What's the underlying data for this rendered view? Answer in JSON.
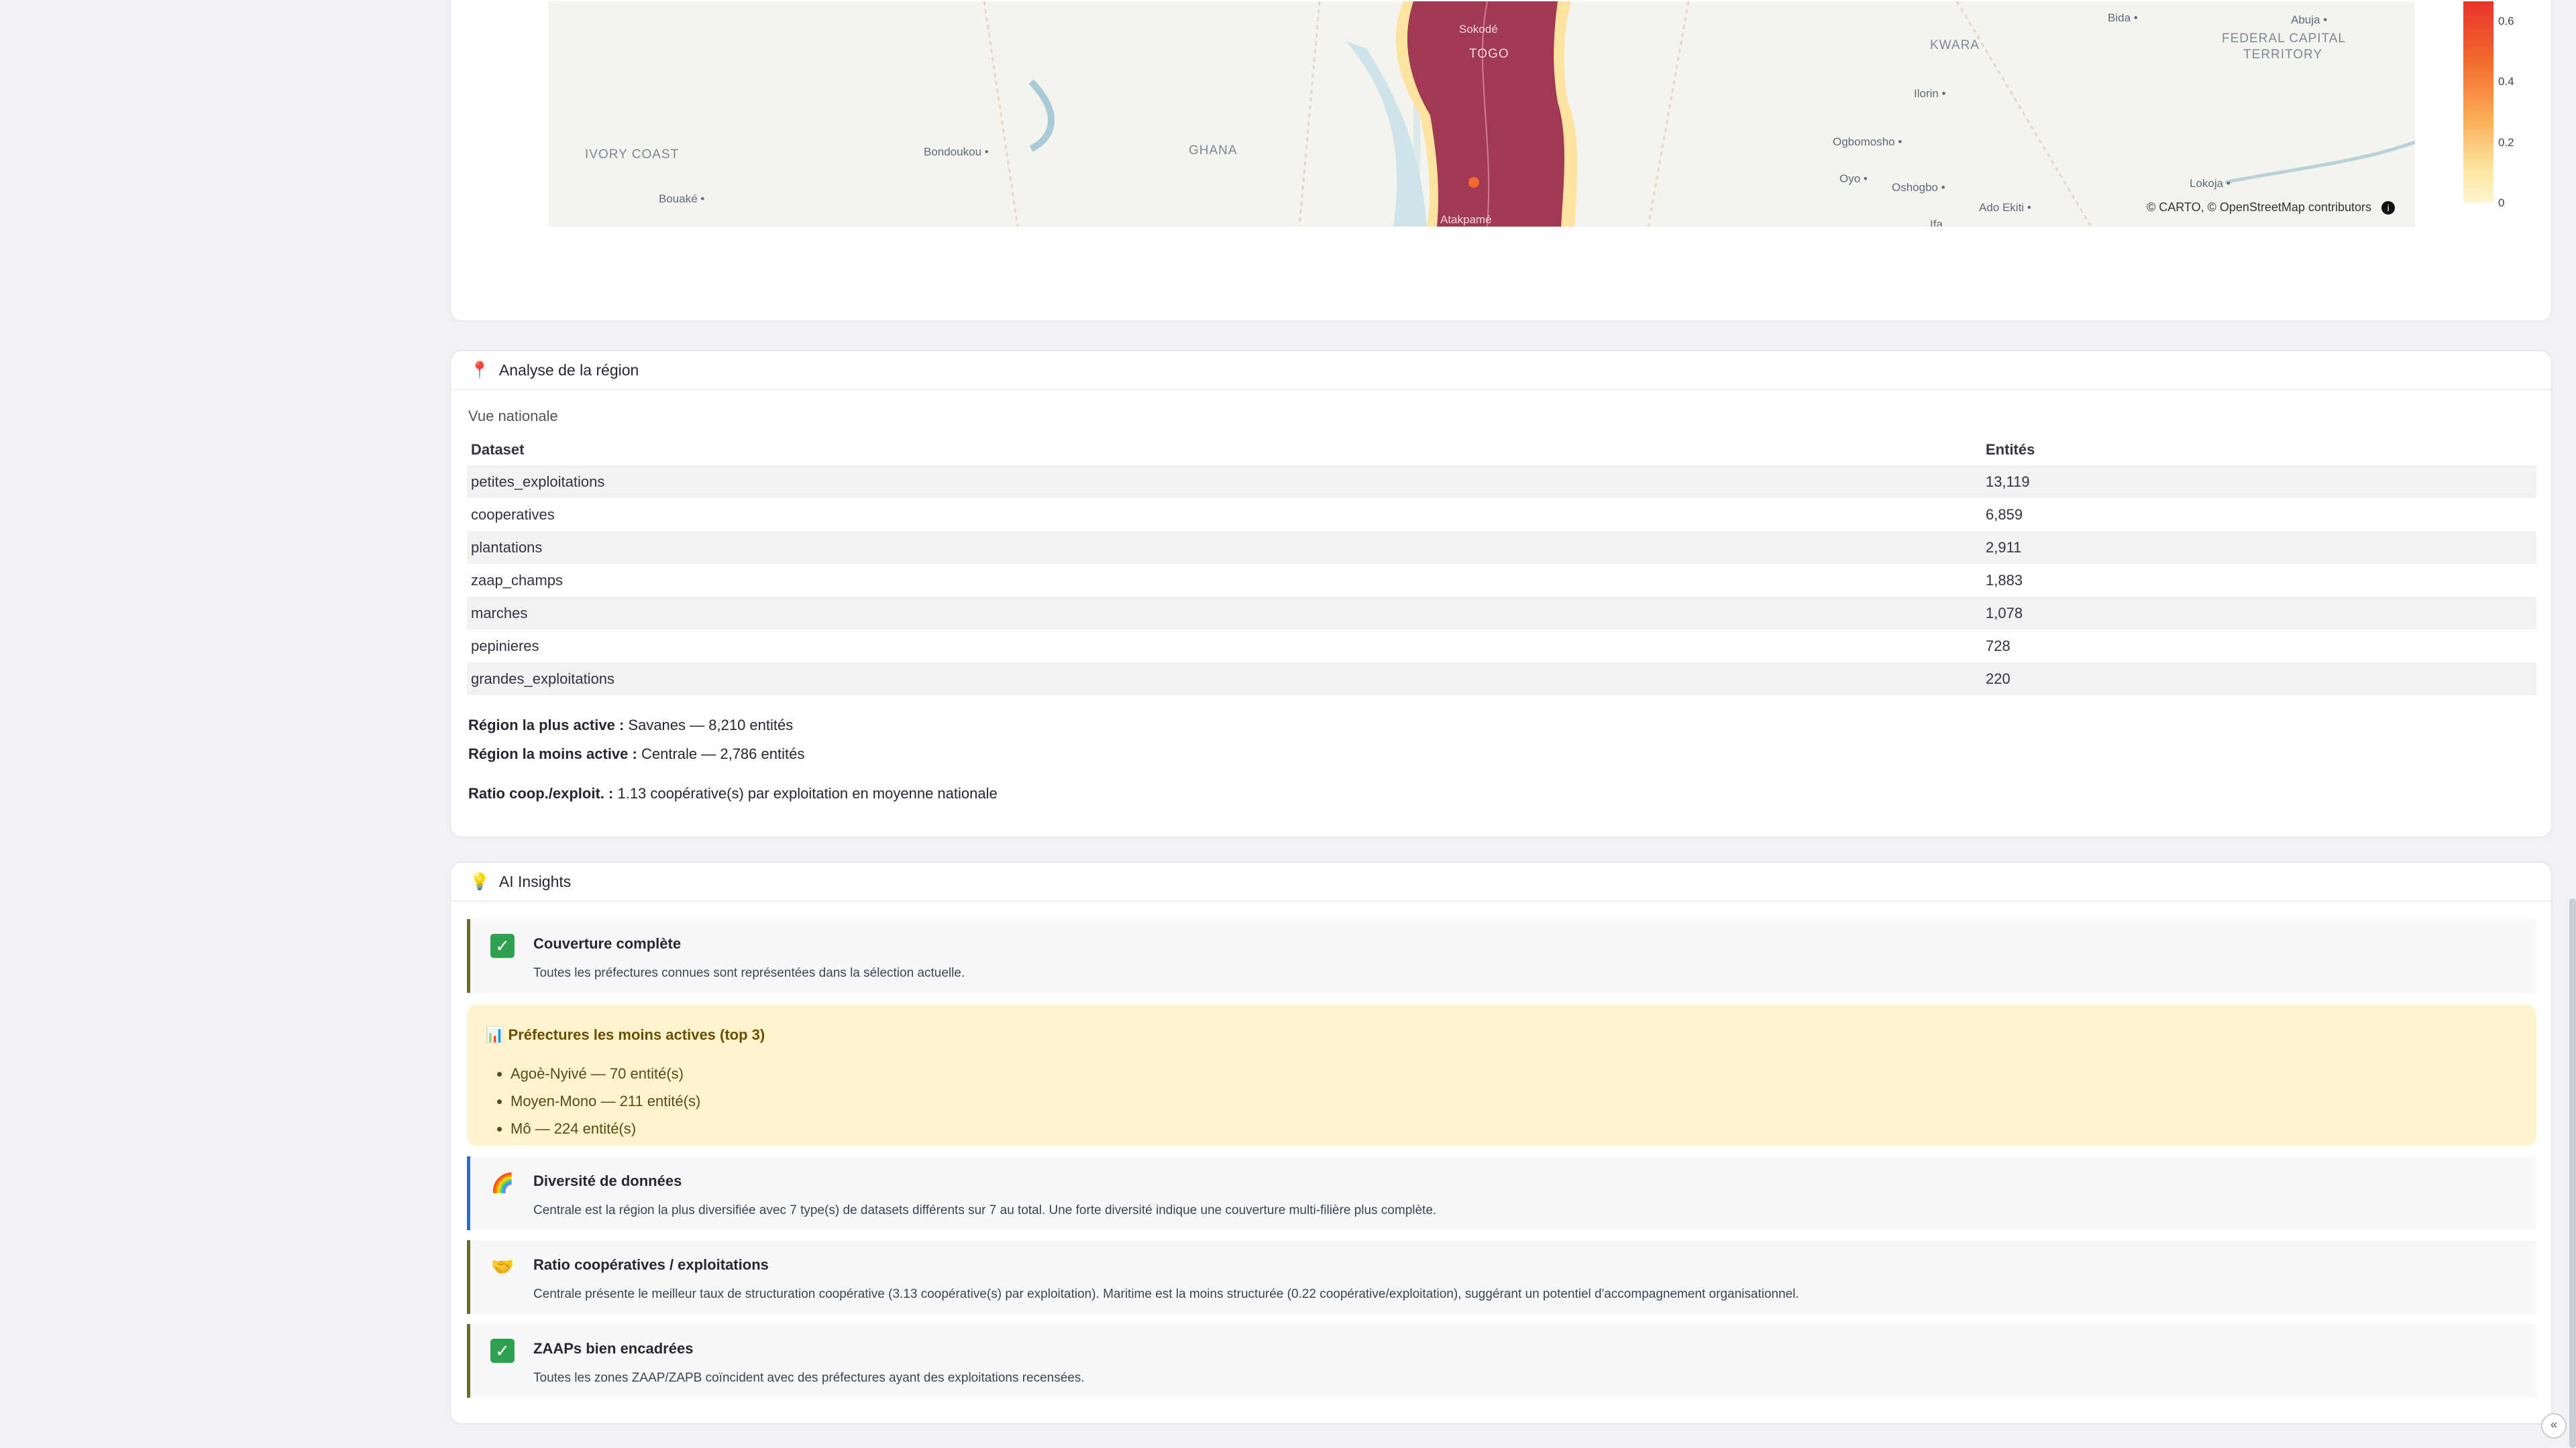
{
  "map": {
    "countries": [
      "IVORY COAST",
      "GHANA",
      "TOGO",
      "KWARA",
      "FEDERAL CAPITAL",
      "TERRITORY"
    ],
    "cities": [
      "Bondoukou",
      "Bouaké",
      "Sokodé",
      "Atakpamé",
      "Ilorin",
      "Ogbomosho",
      "Oyo",
      "Oshogbo",
      "Ado Ekiti",
      "Lokoja",
      "Bida",
      "Abuja",
      "Ifa"
    ],
    "attribution": "© CARTO, © OpenStreetMap contributors",
    "info_icon": "info-icon",
    "colorbar_ticks": [
      "0.6",
      "0.4",
      "0.2",
      "0"
    ]
  },
  "analysis": {
    "icon": "pin-icon",
    "title": "Analyse de la région",
    "subtitle": "Vue nationale",
    "columns": [
      "Dataset",
      "Entités"
    ],
    "rows": [
      [
        "petites_exploitations",
        "13,119"
      ],
      [
        "cooperatives",
        "6,859"
      ],
      [
        "plantations",
        "2,911"
      ],
      [
        "zaap_champs",
        "1,883"
      ],
      [
        "marches",
        "1,078"
      ],
      [
        "pepinieres",
        "728"
      ],
      [
        "grandes_exploitations",
        "220"
      ]
    ],
    "most_active_label": "Région la plus active :",
    "most_active_value": "Savanes — 8,210 entités",
    "least_active_label": "Région la moins active :",
    "least_active_value": "Centrale — 2,786 entités",
    "ratio_label": "Ratio coop./exploit. :",
    "ratio_value": "1.13 coopérative(s) par exploitation en moyenne nationale"
  },
  "insights": {
    "icon": "lightbulb-icon",
    "title": "AI Insights",
    "items": [
      {
        "icon": "check-icon",
        "title": "Couverture complète",
        "desc": "Toutes les préfectures connues sont représentées dans la sélection actuelle."
      },
      {
        "icon": "rainbow-icon",
        "title": "Diversité de données",
        "desc": "Centrale est la région la plus diversifiée avec 7 type(s) de datasets différents sur 7 au total. Une forte diversité indique une couverture multi-filière plus complète."
      },
      {
        "icon": "handshake-icon",
        "title": "Ratio coopératives / exploitations",
        "desc": "Centrale présente le meilleur taux de structuration coopérative (3.13 coopérative(s) par exploitation). Maritime est la moins structurée (0.22 coopérative/exploitation), suggérant un potentiel d'accompagnement organisationnel."
      },
      {
        "icon": "check-icon",
        "title": "ZAAPs bien encadrées",
        "desc": "Toutes les zones ZAAP/ZAPB coïncident avec des préfectures ayant des exploitations recensées."
      }
    ],
    "warning": {
      "icon": "chart-icon",
      "title": "Préfectures les moins actives (top 3)",
      "items": [
        "Agoè-Nyivé — 70 entité(s)",
        "Moyen-Mono — 211 entité(s)",
        "Mô — 224 entité(s)"
      ]
    }
  },
  "sidebar_toggle": "«"
}
